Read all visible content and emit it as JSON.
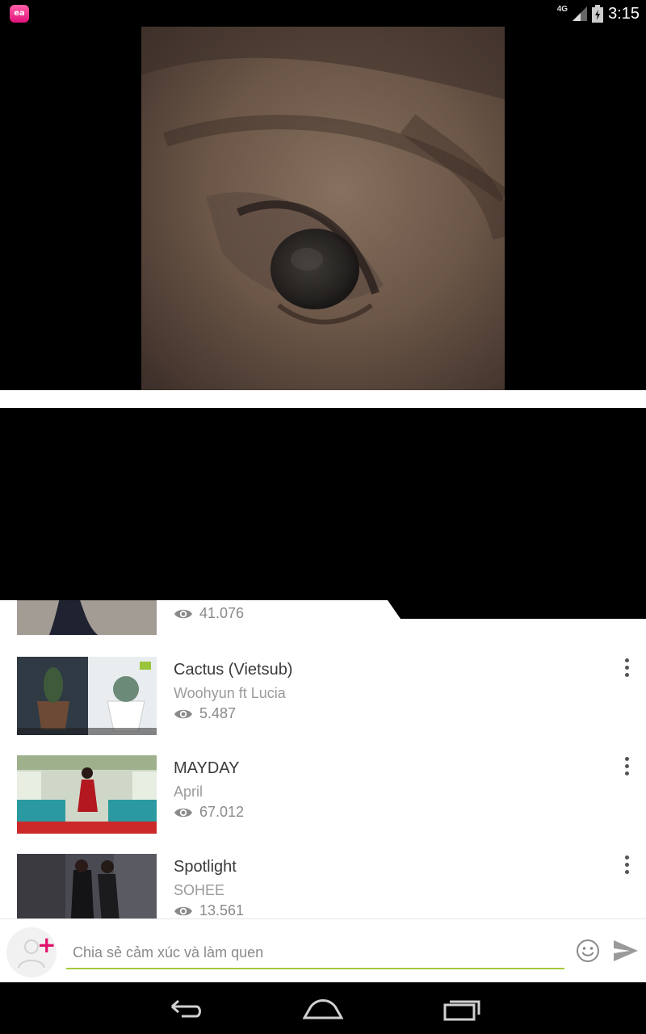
{
  "status_bar": {
    "app_icon_text": "ea",
    "network_label": "4G",
    "time": "3:15"
  },
  "list": {
    "items": [
      {
        "title": "",
        "artist": "",
        "views": "41.076"
      },
      {
        "title": "Cactus (Vietsub)",
        "artist": "Woohyun ft Lucia",
        "views": "5.487"
      },
      {
        "title": "MAYDAY",
        "artist": "April",
        "views": "67.012"
      },
      {
        "title": "Spotlight",
        "artist": "SOHEE",
        "views": "13.561"
      }
    ]
  },
  "chat": {
    "placeholder": "Chia sẻ cảm xúc và làm quen"
  },
  "icons": {
    "app": "app-logo-icon",
    "more": "more-vert-icon",
    "eye": "eye-icon",
    "emoji": "smiley-icon",
    "send": "send-icon",
    "back": "back-icon",
    "home": "home-icon",
    "recents": "recents-icon"
  },
  "colors": {
    "accent_pink": "#e0126a",
    "input_underline": "#a5c93c",
    "text_dark": "#3a3a3a",
    "text_muted": "#9a9a9a"
  }
}
